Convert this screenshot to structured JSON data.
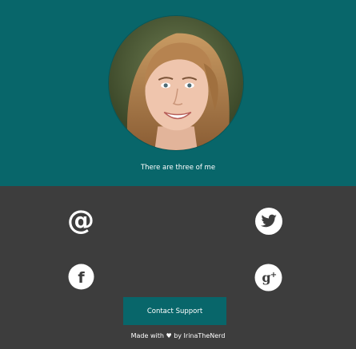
{
  "profile": {
    "tagline": "There are three of me"
  },
  "social": {
    "items": [
      {
        "icon": "at-icon",
        "label": "Email"
      },
      {
        "icon": "twitter-icon",
        "label": "Twitter"
      },
      {
        "icon": "facebook-icon",
        "label": "Facebook"
      },
      {
        "icon": "google-plus-icon",
        "label": "Google+"
      }
    ]
  },
  "contact": {
    "button_label": "Contact Support"
  },
  "footer": {
    "made_with": "Made with",
    "heart": "♥",
    "by_text": "by IrinaTheNerd"
  },
  "colors": {
    "teal": "#08666a",
    "dark": "#3d3d3d",
    "white": "#ffffff"
  }
}
